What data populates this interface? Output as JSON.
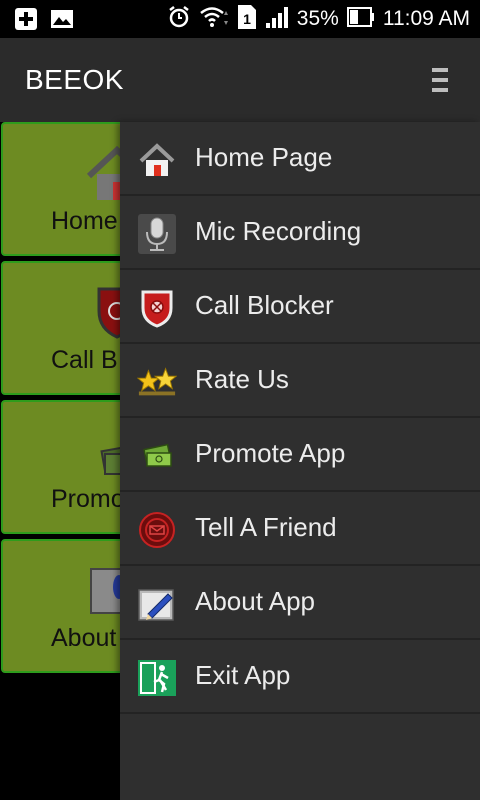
{
  "status_bar": {
    "battery": "35%",
    "time": "11:09 AM",
    "sim_slot": "1"
  },
  "action_bar": {
    "title": "BEEOK"
  },
  "tiles": [
    {
      "label": "Home"
    },
    {
      "label": "Call B"
    },
    {
      "label": "Promo"
    },
    {
      "label": "About"
    }
  ],
  "menu": {
    "items": [
      {
        "label": "Home Page",
        "icon": "home-icon"
      },
      {
        "label": "Mic Recording",
        "icon": "microphone-icon"
      },
      {
        "label": "Call Blocker",
        "icon": "shield-icon"
      },
      {
        "label": "Rate Us",
        "icon": "stars-icon"
      },
      {
        "label": "Promote App",
        "icon": "money-icon"
      },
      {
        "label": "Tell A Friend",
        "icon": "share-icon"
      },
      {
        "label": "About App",
        "icon": "pen-icon"
      },
      {
        "label": "Exit App",
        "icon": "exit-icon"
      }
    ]
  },
  "colors": {
    "drawer_bg": "#2f2f2f",
    "action_bar_bg": "#2b2b2b",
    "tile_bg": "#6d8b22",
    "tile_border": "#2e9c1c"
  }
}
